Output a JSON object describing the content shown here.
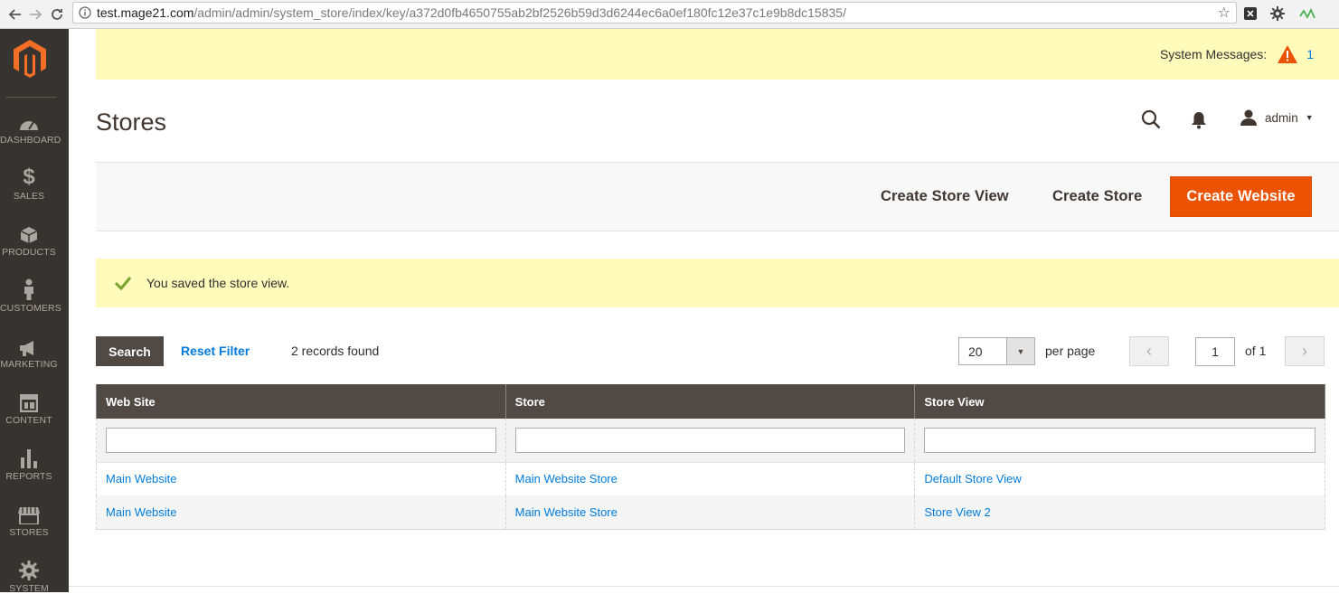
{
  "browser": {
    "url_host": "test.mage21.com",
    "url_path": "/admin/admin/system_store/index/key/a372d0fb4650755ab2bf2526b59d3d6244ec6a0ef180fc12e37c1e9b8dc15835/",
    "icons": [
      "back-icon",
      "forward-icon",
      "reload-icon",
      "info-icon",
      "star-icon",
      "extension-icon",
      "gear-icon",
      "activity-icon"
    ]
  },
  "sidebar": {
    "items": [
      {
        "label": "DASHBOARD",
        "icon": "dashboard-icon"
      },
      {
        "label": "SALES",
        "icon": "dollar-icon"
      },
      {
        "label": "PRODUCTS",
        "icon": "box-icon"
      },
      {
        "label": "CUSTOMERS",
        "icon": "person-icon"
      },
      {
        "label": "MARKETING",
        "icon": "megaphone-icon"
      },
      {
        "label": "CONTENT",
        "icon": "layout-icon"
      },
      {
        "label": "REPORTS",
        "icon": "bar-chart-icon"
      },
      {
        "label": "STORES",
        "icon": "store-icon"
      },
      {
        "label": "SYSTEM",
        "icon": "gear-icon"
      }
    ]
  },
  "system_messages": {
    "label": "System Messages:",
    "count": "1"
  },
  "header": {
    "title": "Stores",
    "user": "admin"
  },
  "actions": {
    "create_store_view": "Create Store View",
    "create_store": "Create Store",
    "create_website": "Create Website"
  },
  "success_message": "You saved the store view.",
  "grid_toolbar": {
    "search": "Search",
    "reset_filter": "Reset Filter",
    "records": "2 records found",
    "per_page_value": "20",
    "per_page_label": "per page",
    "page_value": "1",
    "page_of": "of 1"
  },
  "grid": {
    "columns": [
      "Web Site",
      "Store",
      "Store View"
    ],
    "rows": [
      [
        "Main Website",
        "Main Website Store",
        "Default Store View"
      ],
      [
        "Main Website",
        "Main Website Store",
        "Store View 2"
      ]
    ]
  },
  "colors": {
    "accent": "#eb5202",
    "sidebar": "#373330",
    "header_row": "#514943",
    "link": "#007bdb",
    "notice_bg": "#fffbbb"
  }
}
